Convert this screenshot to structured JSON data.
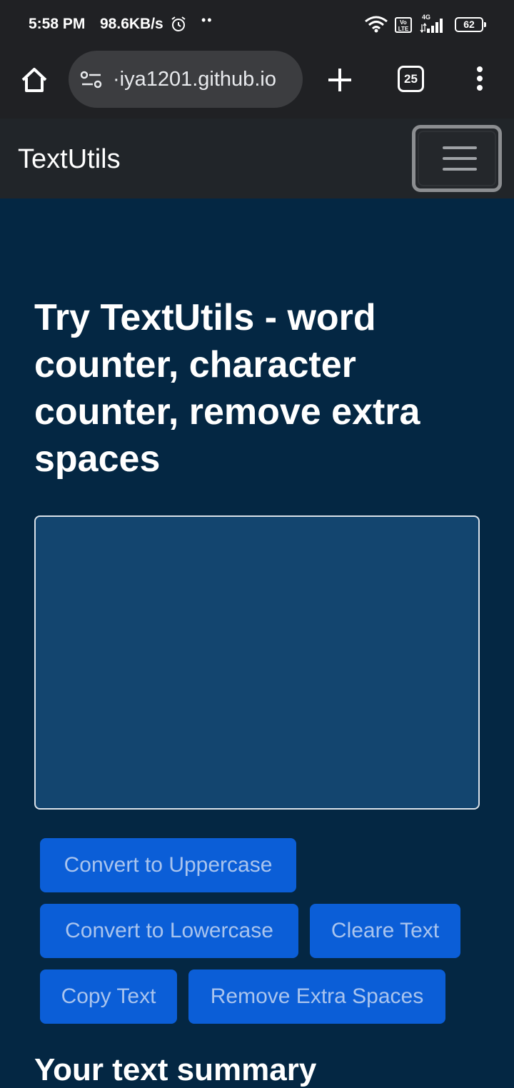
{
  "status_bar": {
    "time": "5:58 PM",
    "speed": "98.6KB/s",
    "network": "4G",
    "volte": "Vo LTE",
    "battery": "62"
  },
  "browser": {
    "url": "·iya1201.github.io",
    "tab_count": "25"
  },
  "navbar": {
    "brand": "TextUtils"
  },
  "main": {
    "heading": "Try TextUtils - word counter, character counter, remove extra spaces",
    "textarea_value": "",
    "buttons": {
      "uppercase": "Convert to Uppercase",
      "lowercase": "Convert to Lowercase",
      "clear": "Cleare Text",
      "copy": "Copy Text",
      "remove_spaces": "Remove Extra Spaces"
    },
    "summary_heading": "Your text summary"
  },
  "colors": {
    "page_bg": "#042743",
    "navbar_bg": "#212529",
    "button_bg": "#0b5ed7",
    "textarea_bg": "#13456f"
  }
}
